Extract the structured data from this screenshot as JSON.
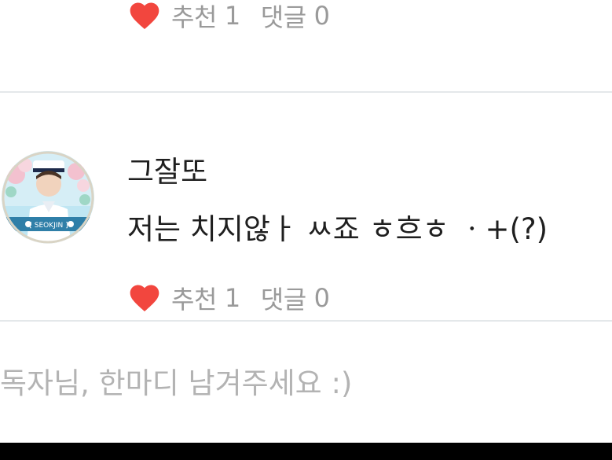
{
  "comments": [
    {
      "likes_label": "추천",
      "likes_count": "1",
      "replies_label": "댓글",
      "replies_count": "0"
    },
    {
      "author": "그잘또",
      "text": "저는 치지않ㅏ ㅆ죠 ㅎ흐ㅎ ㆍ+(?)",
      "avatar_badge_text": "[ SEOKJIN ]",
      "likes_label": "추천",
      "likes_count": "1",
      "replies_label": "댓글",
      "replies_count": "0"
    }
  ],
  "comment_input": {
    "placeholder": "독자님, 한마디 남겨주세요 :)"
  },
  "colors": {
    "heart": "#f2463e",
    "meta_text": "#9a9a9a",
    "divider": "#e4e8ea",
    "placeholder": "#b3b3b3",
    "body_text": "#1f1f1f"
  }
}
